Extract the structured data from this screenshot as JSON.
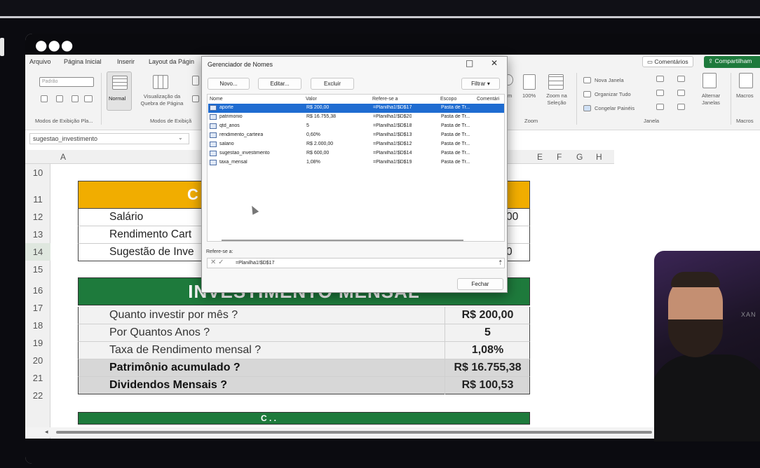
{
  "menu": {
    "items": [
      "Arquivo",
      "Página Inicial",
      "Inserir",
      "Layout da Págin"
    ],
    "comments_label": "Comentários",
    "share_label": "Compartilham"
  },
  "ribbon": {
    "font_box": "Padrão",
    "normal_label": "Normal",
    "page_break_label": "Visualização da Quebra de Página",
    "group_modes_label": "Modos de Exibição Pla...",
    "group_workbook_label": "Modos de Exibiçã",
    "zoom_100_label": "100%",
    "zoom_sel_label": "Zoom na Seleção",
    "zoom_group_label": "Zoom",
    "new_window_label": "Nova Janela",
    "arrange_label": "Organizar Tudo",
    "freeze_label": "Congelar Painéis",
    "window_group_label": "Janela",
    "switch_label": "Alternar Janelas",
    "macros_label": "Macros",
    "macros_group_label": "Macros",
    "zoom_partial": "m"
  },
  "namebox": {
    "value": "sugestao_investimento"
  },
  "columns": [
    "A",
    "E",
    "F",
    "G",
    "H"
  ],
  "rows": [
    "10",
    "11",
    "12",
    "13",
    "14",
    "15",
    "16",
    "17",
    "18",
    "19",
    "20",
    "21",
    "22"
  ],
  "sheet": {
    "table1_title_fragment": "C",
    "table1_rows": [
      {
        "label": "Salário",
        "value_fragment": "00"
      },
      {
        "label": "Rendimento Cart",
        "value_fragment": ""
      },
      {
        "label": "Sugestão de Inve",
        "value_fragment": "0"
      }
    ],
    "table2_title": "INVESTIMENTO MENSAL",
    "table2_rows": [
      {
        "label": "Quanto investir por mês ?",
        "value": "R$ 200,00"
      },
      {
        "label": "Por Quantos Anos ?",
        "value": "5"
      },
      {
        "label": "Taxa de Rendimento mensal ?",
        "value": "1,08%"
      },
      {
        "label": "Patrimônio acumulado ?",
        "value": "R$ 16.755,38"
      },
      {
        "label": "Dividendos Mensais ?",
        "value": "R$ 100,53"
      }
    ],
    "table3_title_fragment": "C  . ."
  },
  "dialog": {
    "title": "Gerenciador de Nomes",
    "btn_new": "Novo...",
    "btn_edit": "Editar...",
    "btn_delete": "Excluir",
    "btn_filter": "Filtrar",
    "columns": [
      "Nome",
      "Valor",
      "Refere-se a",
      "Escopo",
      "Comentári"
    ],
    "names": [
      {
        "name": "aporte",
        "value": "R$ 200,00",
        "ref": "=Planilha1!$D$17",
        "scope": "Pasta de Tr..."
      },
      {
        "name": "patrimonio",
        "value": "R$ 16.755,38",
        "ref": "=Planilha1!$D$20",
        "scope": "Pasta de Tr..."
      },
      {
        "name": "qtd_anos",
        "value": "5",
        "ref": "=Planilha1!$D$18",
        "scope": "Pasta de Tr..."
      },
      {
        "name": "rendimento_carteira",
        "value": "0,60%",
        "ref": "=Planilha1!$D$13",
        "scope": "Pasta de Tr..."
      },
      {
        "name": "salario",
        "value": "R$ 2.000,00",
        "ref": "=Planilha1!$D$12",
        "scope": "Pasta de Tr..."
      },
      {
        "name": "sugestao_investimento",
        "value": "R$ 600,00",
        "ref": "=Planilha1!$D$14",
        "scope": "Pasta de Tr..."
      },
      {
        "name": "taxa_mensal",
        "value": "1,08%",
        "ref": "=Planilha1!$D$19",
        "scope": "Pasta de Tr..."
      }
    ],
    "refers_label": "Refere-se a:",
    "refers_value": "=Planilha1!$D$17",
    "btn_close": "Fechar"
  },
  "webcam": {
    "sign_text": "XAN"
  }
}
